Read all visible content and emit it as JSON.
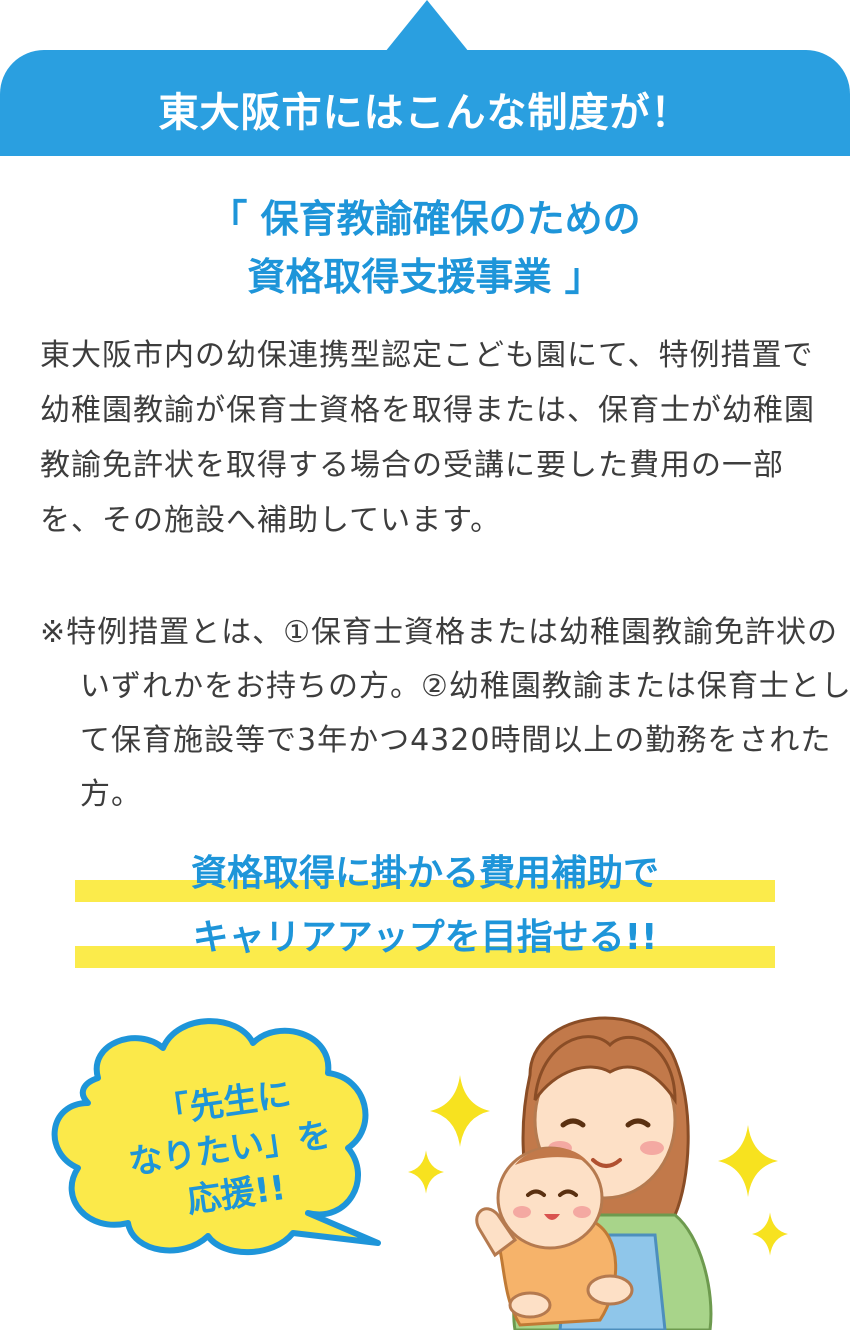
{
  "header": {
    "title": "東大阪市にはこんな制度が！"
  },
  "program": {
    "title_line1": "「 保育教諭確保のための",
    "title_line2": "資格取得支援事業 」"
  },
  "description": "東大阪市内の幼保連携型認定こども園にて、特例措置で幼稚園教諭が保育士資格を取得または、保育士が幼稚園教諭免許状を取得する場合の受講に要した費用の一部を、その施設へ補助しています。",
  "note": "※特例措置とは、①保育士資格または幼稚園教諭免許状のいずれかをお持ちの方。②幼稚園教諭または保育士として保育施設等で3年かつ4320時間以上の勤務をされた方。",
  "slogan": {
    "line1": "資格取得に掛かる費用補助で",
    "line2": "キャリアアップを目指せる!!"
  },
  "bubble": {
    "line1": "「先生に",
    "line2": "なりたい」を",
    "line3": "応援!!"
  },
  "colors": {
    "accent_blue": "#2a9fe0",
    "highlight_yellow": "#fbeb4b",
    "bubble_yellow": "#fbe94a",
    "sparkle_yellow": "#f7e21f"
  },
  "icons": [
    "sparkle-icon",
    "speech-bubble",
    "mother-and-baby-illustration"
  ]
}
